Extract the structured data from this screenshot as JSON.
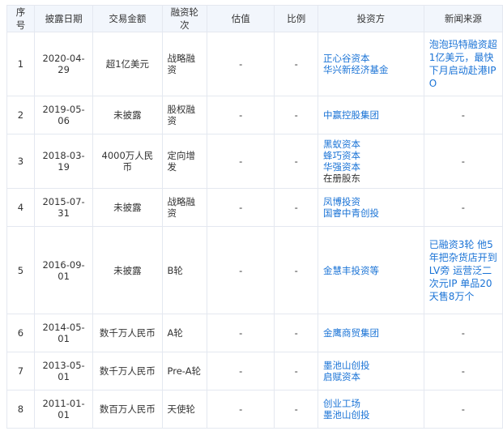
{
  "headers": [
    "序号",
    "披露日期",
    "交易金额",
    "融资轮次",
    "估值",
    "比例",
    "投资方",
    "新闻来源"
  ],
  "rows": [
    {
      "no": "1",
      "date": "2020-04-29",
      "amount": "超1亿美元",
      "round": "战略融资",
      "valuation": "-",
      "ratio": "-",
      "investors": [
        "正心谷资本",
        "华兴新经济基金"
      ],
      "news": "泡泡玛特融资超1亿美元，最快下月启动赴港IPO"
    },
    {
      "no": "2",
      "date": "2019-05-06",
      "amount": "未披露",
      "round": "股权融资",
      "valuation": "-",
      "ratio": "-",
      "investors": [
        "中赢控股集团"
      ],
      "news": "-"
    },
    {
      "no": "3",
      "date": "2018-03-19",
      "amount": "4000万人民币",
      "round": "定向增发",
      "valuation": "-",
      "ratio": "-",
      "investors": [
        "黑蚁资本",
        "蜂巧资本",
        "华强资本",
        "在册股东"
      ],
      "news": "-"
    },
    {
      "no": "4",
      "date": "2015-07-31",
      "amount": "未披露",
      "round": "战略融资",
      "valuation": "-",
      "ratio": "-",
      "investors": [
        "凤博投资",
        "国睿中青创投"
      ],
      "news": "-"
    },
    {
      "no": "5",
      "date": "2016-09-01",
      "amount": "未披露",
      "round": "B轮",
      "valuation": "-",
      "ratio": "-",
      "investors": [
        "金慧丰投资等"
      ],
      "news": "已融资3轮 他5年把杂货店开到LV旁 运营泛二次元IP 单品20天售8万个"
    },
    {
      "no": "6",
      "date": "2014-05-01",
      "amount": "数千万人民币",
      "round": "A轮",
      "valuation": "-",
      "ratio": "-",
      "investors": [
        "金鹰商贸集团"
      ],
      "news": "-"
    },
    {
      "no": "7",
      "date": "2013-05-01",
      "amount": "数千万人民币",
      "round": "Pre-A轮",
      "valuation": "-",
      "ratio": "-",
      "investors": [
        "墨池山创投",
        "启赋资本"
      ],
      "news": "-"
    },
    {
      "no": "8",
      "date": "2011-01-01",
      "amount": "数百万人民币",
      "round": "天使轮",
      "valuation": "-",
      "ratio": "-",
      "investors": [
        "创业工场",
        "墨池山创投"
      ],
      "news": "-"
    }
  ]
}
